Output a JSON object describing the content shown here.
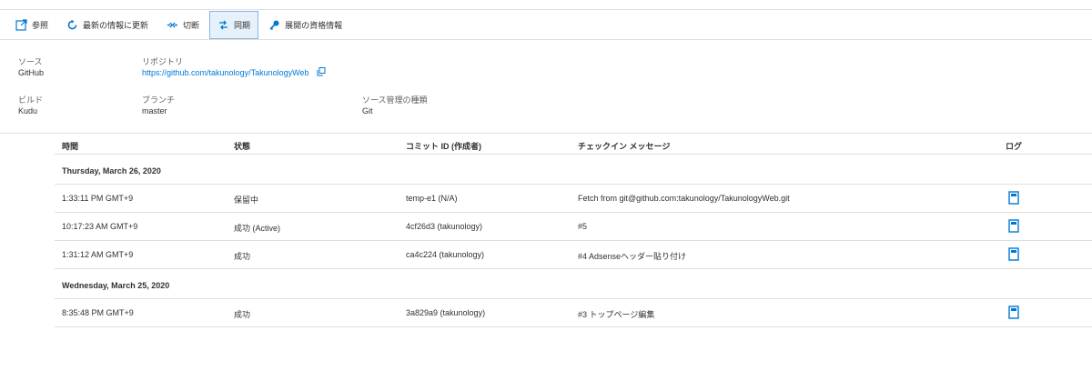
{
  "toolbar": {
    "browse": "参照",
    "refresh": "最新の情報に更新",
    "disconnect": "切断",
    "sync": "同期",
    "credentials": "展開の資格情報"
  },
  "info": {
    "source_label": "ソース",
    "source_value": "GitHub",
    "repo_label": "リポジトリ",
    "repo_value": "https://github.com/takunology/TakunologyWeb",
    "build_label": "ビルド",
    "build_value": "Kudu",
    "branch_label": "ブランチ",
    "branch_value": "master",
    "scm_label": "ソース管理の種類",
    "scm_value": "Git"
  },
  "table": {
    "headers": {
      "time": "時間",
      "status": "状態",
      "commit": "コミット ID (作成者)",
      "message": "チェックイン メッセージ",
      "log": "ログ"
    },
    "groups": [
      {
        "date": "Thursday, March 26, 2020",
        "rows": [
          {
            "time": "1:33:11 PM GMT+9",
            "status": "保留中",
            "commit": "temp-e1 (N/A)",
            "message": "Fetch from git@github.com:takunology/TakunologyWeb.git"
          },
          {
            "time": "10:17:23 AM GMT+9",
            "status": "成功 (Active)",
            "commit": "4cf26d3 (takunology)",
            "message": "#5"
          },
          {
            "time": "1:31:12 AM GMT+9",
            "status": "成功",
            "commit": "ca4c224 (takunology)",
            "message": "#4 Adsenseヘッダー貼り付け"
          }
        ]
      },
      {
        "date": "Wednesday, March 25, 2020",
        "rows": [
          {
            "time": "8:35:48 PM GMT+9",
            "status": "成功",
            "commit": "3a829a9 (takunology)",
            "message": "#3 トップページ編集"
          }
        ]
      }
    ]
  },
  "icons": {
    "browse": "open-external-icon",
    "refresh": "refresh-icon",
    "disconnect": "disconnect-icon",
    "sync": "sync-icon",
    "credentials": "key-icon",
    "copy": "copy-icon",
    "log": "log-document-icon"
  },
  "colors": {
    "accent": "#0078d4",
    "active_bg": "#e5f1fb",
    "border": "#e1dfdd"
  }
}
